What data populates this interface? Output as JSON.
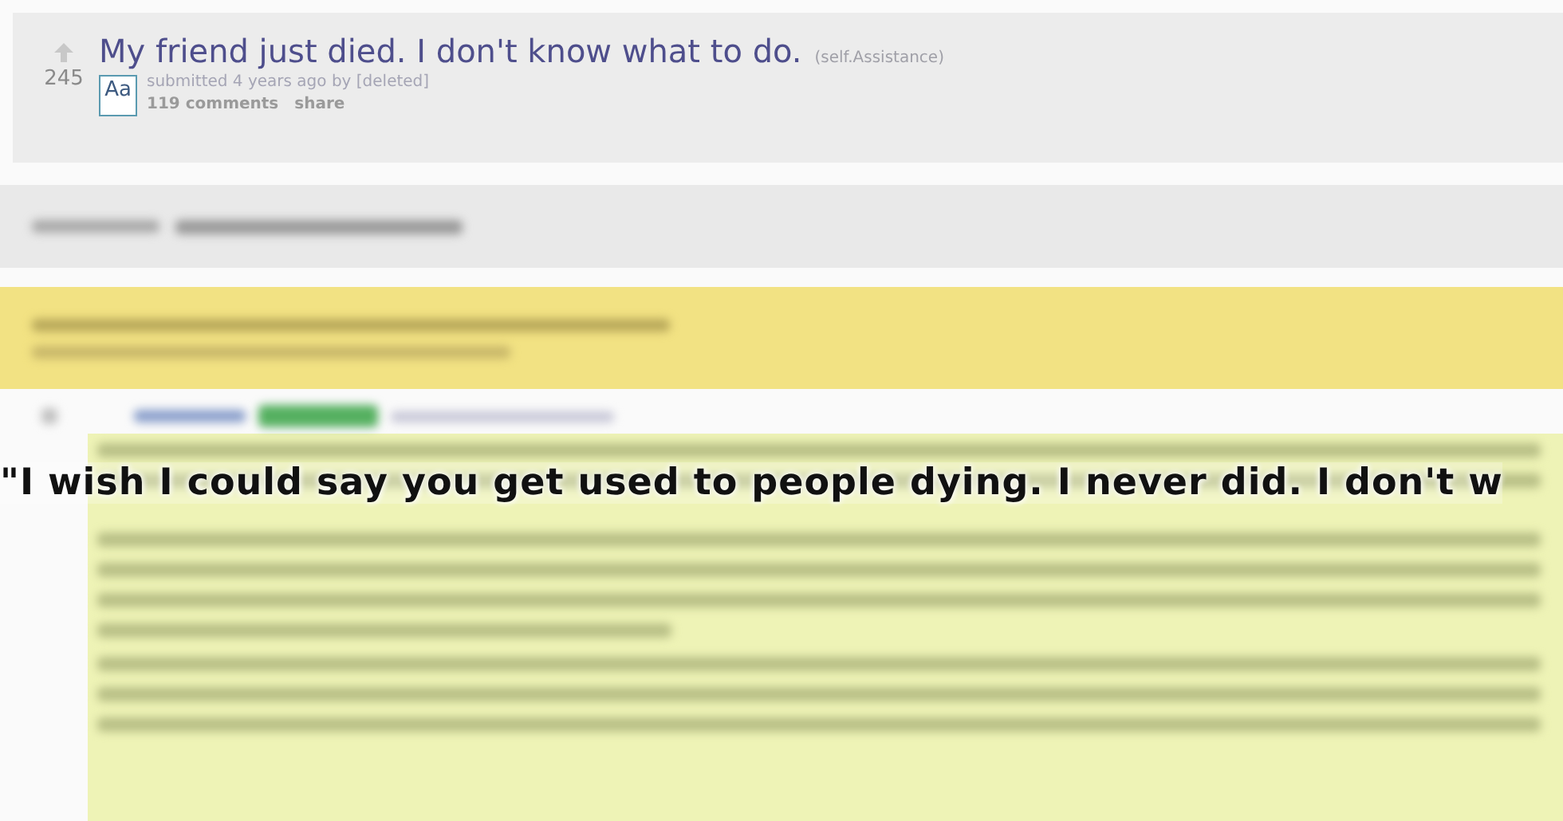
{
  "post": {
    "score": "245",
    "title": "My friend just died. I don't know what to do.",
    "domain": "(self.Assistance)",
    "thumbnail_label": "Aa",
    "tagline": "submitted 4 years ago by [deleted]",
    "links": [
      "119 comments",
      "share"
    ]
  },
  "caption": "\"I wish I could say you get used to people dying. I never did. I don't w"
}
